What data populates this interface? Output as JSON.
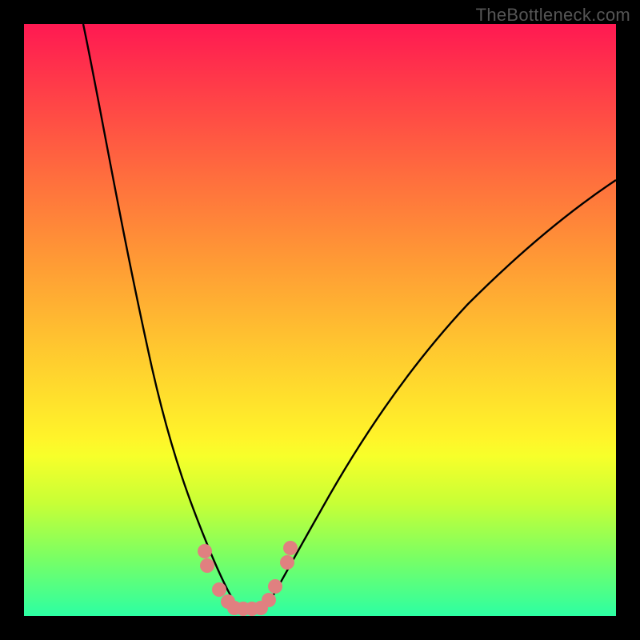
{
  "watermark": "TheBottleneck.com",
  "chart_data": {
    "type": "line",
    "title": "",
    "xlabel": "",
    "ylabel": "",
    "x_range": [
      0,
      100
    ],
    "y_range": [
      0,
      100
    ],
    "background_gradient": {
      "orientation": "vertical",
      "stops": [
        {
          "pos": 0,
          "color": "#ff1952"
        },
        {
          "pos": 10,
          "color": "#ff3a49"
        },
        {
          "pos": 25,
          "color": "#ff6b3e"
        },
        {
          "pos": 40,
          "color": "#ff9a35"
        },
        {
          "pos": 55,
          "color": "#ffc82f"
        },
        {
          "pos": 70,
          "color": "#fff42a"
        },
        {
          "pos": 81,
          "color": "#c7ff36"
        },
        {
          "pos": 90,
          "color": "#7bff63"
        },
        {
          "pos": 100,
          "color": "#2cffa3"
        }
      ]
    },
    "series": [
      {
        "name": "left-curve",
        "x": [
          10,
          14,
          18,
          22,
          25,
          27,
          29,
          31,
          33,
          35,
          36,
          37
        ],
        "y": [
          100,
          80,
          60,
          42,
          30,
          22,
          16,
          11,
          7,
          4,
          2,
          0
        ]
      },
      {
        "name": "right-curve",
        "x": [
          40,
          42,
          45,
          50,
          55,
          60,
          65,
          70,
          75,
          80,
          85,
          90,
          95,
          100
        ],
        "y": [
          0,
          3,
          8,
          17,
          26,
          34,
          41,
          47,
          53,
          58,
          63,
          67,
          71,
          74
        ]
      }
    ],
    "markers": [
      {
        "x": 30.5,
        "y": 11
      },
      {
        "x": 31.0,
        "y": 8.5
      },
      {
        "x": 33.0,
        "y": 4.5
      },
      {
        "x": 34.4,
        "y": 2.5
      },
      {
        "x": 35.5,
        "y": 1.4
      },
      {
        "x": 37.0,
        "y": 1.2
      },
      {
        "x": 38.5,
        "y": 1.2
      },
      {
        "x": 40.0,
        "y": 1.4
      },
      {
        "x": 41.3,
        "y": 2.7
      },
      {
        "x": 42.5,
        "y": 5
      },
      {
        "x": 44.5,
        "y": 9
      },
      {
        "x": 45.0,
        "y": 11.5
      }
    ],
    "legend": null,
    "annotations": []
  }
}
